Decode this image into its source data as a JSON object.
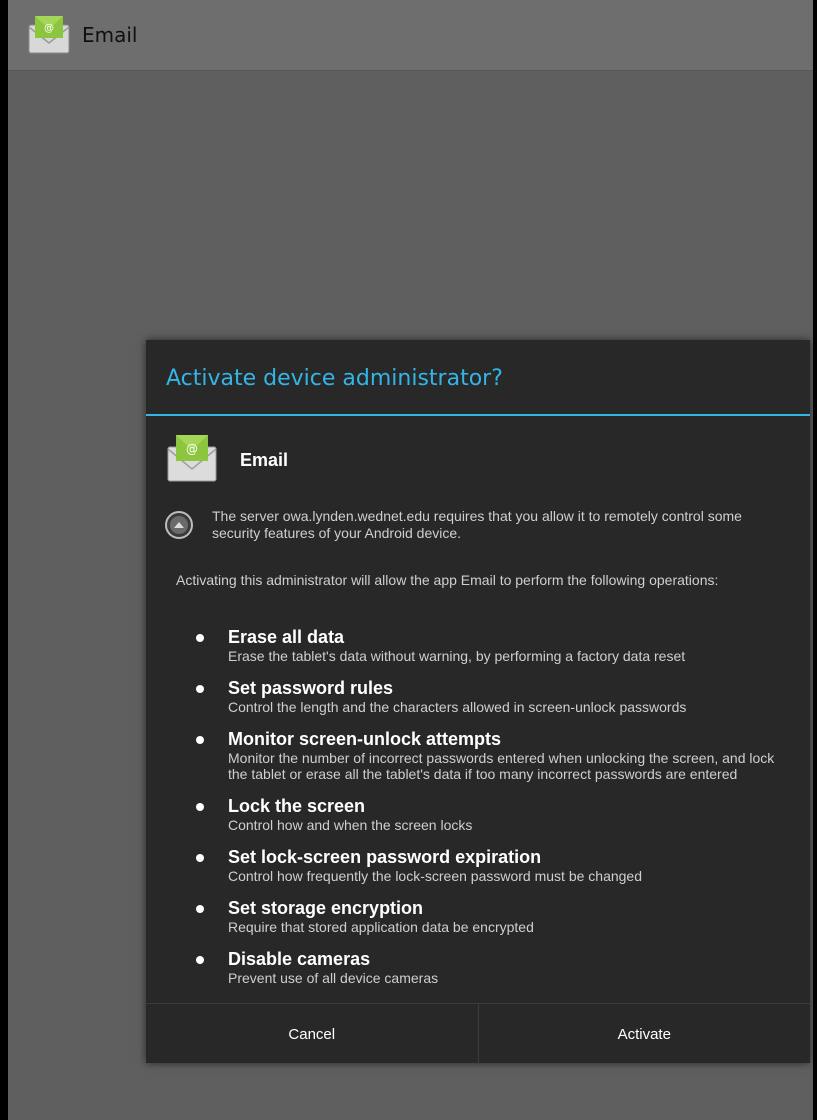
{
  "action_bar": {
    "title": "Email",
    "icon": "email-envelope-icon"
  },
  "dialog": {
    "title": "Activate device administrator?",
    "app": {
      "name": "Email",
      "icon": "email-envelope-icon"
    },
    "server_message": "The server owa.lynden.wednet.edu requires that you allow it to remotely control some security features of your Android device.",
    "expand_icon": "expand-up-icon",
    "intro": "Activating this administrator will allow the app Email to perform the following operations:",
    "policies": [
      {
        "title": "Erase all data",
        "description": "Erase the tablet's data without warning, by performing a factory data reset"
      },
      {
        "title": "Set password rules",
        "description": "Control the length and the characters allowed in screen-unlock passwords"
      },
      {
        "title": "Monitor screen-unlock attempts",
        "description": "Monitor the number of incorrect passwords entered when unlocking the screen, and lock the tablet or erase all the tablet's data if too many incorrect passwords are entered"
      },
      {
        "title": "Lock the screen",
        "description": "Control how and when the screen locks"
      },
      {
        "title": "Set lock-screen password expiration",
        "description": "Control how frequently the lock-screen password must be changed"
      },
      {
        "title": "Set storage encryption",
        "description": "Require that stored application data be encrypted"
      },
      {
        "title": "Disable cameras",
        "description": "Prevent use of all device cameras"
      }
    ],
    "buttons": {
      "cancel": "Cancel",
      "activate": "Activate"
    }
  },
  "colors": {
    "accent": "#33b5e5",
    "dialog_bg": "#282828",
    "backdrop": "#5f5f5f",
    "action_bar": "#6e6e6e"
  }
}
